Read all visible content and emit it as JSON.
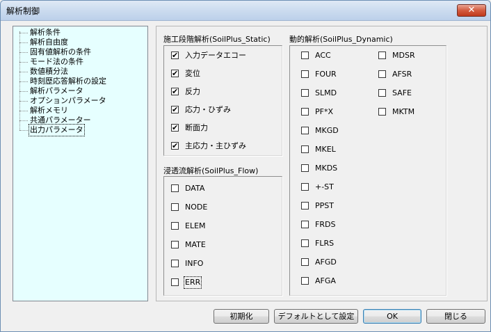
{
  "window": {
    "title": "解析制御",
    "close_label": "✕"
  },
  "tree": {
    "items": [
      "解析条件",
      "解析自由度",
      "固有値解析の条件",
      "モード法の条件",
      "数値積分法",
      "時刻歴応答解析の設定",
      "解析パラメータ",
      "オプションパラメータ",
      "解析メモリ",
      "共通パラメーター",
      "出力パラメータ"
    ],
    "selected": "出力パラメータ"
  },
  "static_group": {
    "label": "施工段階解析(SoilPlus_Static)",
    "items": [
      {
        "label": "入力データエコー",
        "checked": true
      },
      {
        "label": "変位",
        "checked": true
      },
      {
        "label": "反力",
        "checked": true
      },
      {
        "label": "応力・ひずみ",
        "checked": true
      },
      {
        "label": "断面力",
        "checked": true
      },
      {
        "label": "主応力・主ひずみ",
        "checked": true
      }
    ]
  },
  "flow_group": {
    "label": "浸透流解析(SoilPlus_Flow)",
    "items": [
      {
        "label": "DATA",
        "checked": false
      },
      {
        "label": "NODE",
        "checked": false
      },
      {
        "label": "ELEM",
        "checked": false
      },
      {
        "label": "MATE",
        "checked": false
      },
      {
        "label": "INFO",
        "checked": false
      },
      {
        "label": "ERR",
        "checked": false
      }
    ]
  },
  "dynamic_group": {
    "label": "動的解析(SoilPlus_Dynamic)",
    "col1": [
      {
        "label": "ACC",
        "checked": false
      },
      {
        "label": "FOUR",
        "checked": false
      },
      {
        "label": "SLMD",
        "checked": false
      },
      {
        "label": "PF*X",
        "checked": false
      },
      {
        "label": "MKGD",
        "checked": false
      },
      {
        "label": "MKEL",
        "checked": false
      },
      {
        "label": "MKDS",
        "checked": false
      },
      {
        "label": "+-ST",
        "checked": false
      },
      {
        "label": "PPST",
        "checked": false
      },
      {
        "label": "FRDS",
        "checked": false
      },
      {
        "label": "FLRS",
        "checked": false
      },
      {
        "label": "AFGD",
        "checked": false
      },
      {
        "label": "AFGA",
        "checked": false
      }
    ],
    "col2": [
      {
        "label": "MDSR",
        "checked": false
      },
      {
        "label": "AFSR",
        "checked": false
      },
      {
        "label": "SAFE",
        "checked": false
      },
      {
        "label": "MKTM",
        "checked": false
      }
    ]
  },
  "buttons": {
    "initialize": "初期化",
    "set_default": "デフォルトとして設定",
    "ok": "OK",
    "close": "閉じる"
  },
  "check_glyph": "✔"
}
